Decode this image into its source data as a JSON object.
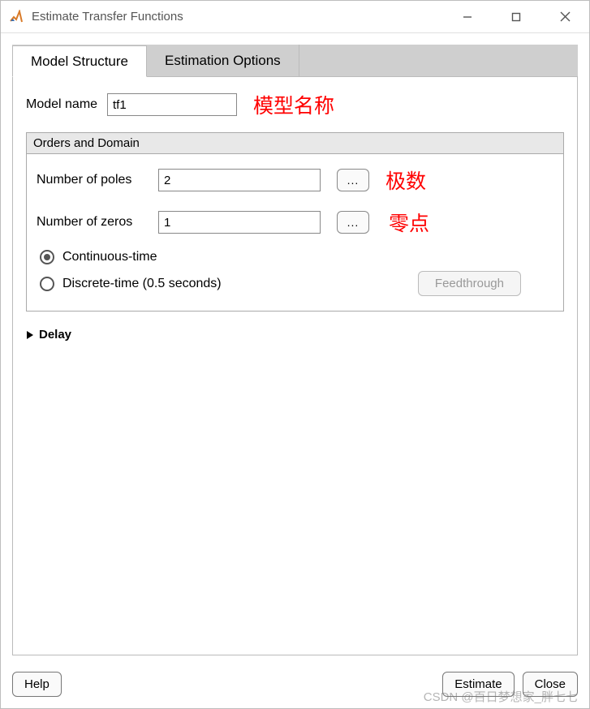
{
  "window": {
    "title": "Estimate Transfer Functions"
  },
  "tabs": [
    {
      "label": "Model Structure",
      "active": true
    },
    {
      "label": "Estimation Options",
      "active": false
    }
  ],
  "model_name": {
    "label": "Model name",
    "value": "tf1"
  },
  "orders": {
    "title": "Orders and Domain",
    "poles": {
      "label": "Number of poles",
      "value": "2"
    },
    "zeros": {
      "label": "Number of zeros",
      "value": "1"
    },
    "ellipsis": "..."
  },
  "time_domain": {
    "continuous": "Continuous-time",
    "discrete": "Discrete-time (0.5 seconds)",
    "selected": "continuous",
    "feedthrough": "Feedthrough"
  },
  "delay": {
    "label": "Delay"
  },
  "buttons": {
    "help": "Help",
    "estimate": "Estimate",
    "close": "Close"
  },
  "annotations": {
    "model_name": "模型名称",
    "poles": "极数",
    "zeros": "零点"
  },
  "watermark": "CSDN @百日梦想家_胖七七"
}
